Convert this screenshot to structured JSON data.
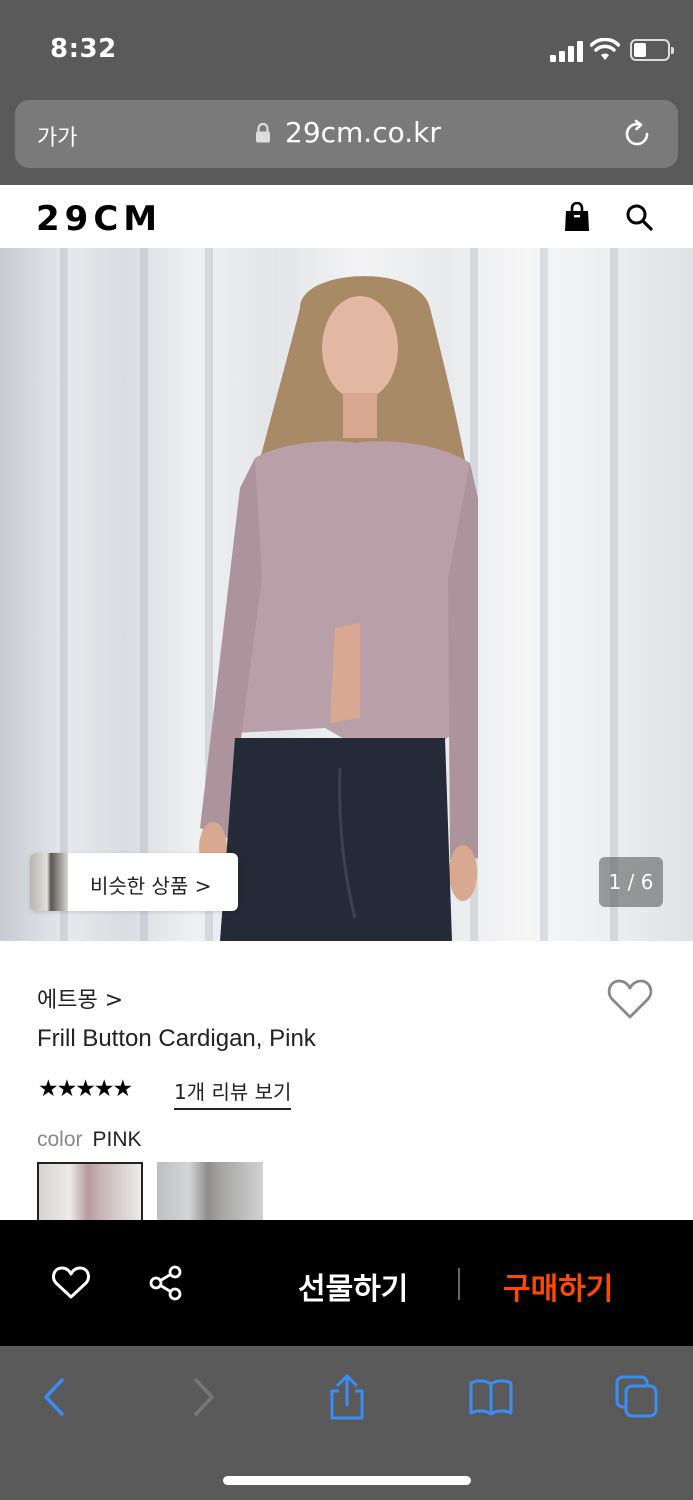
{
  "status_bar": {
    "time": "8:32"
  },
  "browser": {
    "text_size_button": "가가",
    "url": "29cm.co.kr"
  },
  "site_header": {
    "logo": "29CM"
  },
  "hero": {
    "similar_products_label": "비슷한 상품 >",
    "pager": "1 / 6"
  },
  "product": {
    "brand": "에트몽 >",
    "name": "Frill Button Cardigan, Pink",
    "stars": "★★★★★",
    "rating": 5,
    "review_link": "1개 리뷰 보기",
    "color_label": "color",
    "color_value": "PINK"
  },
  "action_bar": {
    "gift_label": "선물하기",
    "buy_label": "구매하기",
    "buy_color": "#ff4800"
  },
  "icons": [
    "lock-icon",
    "reload-icon",
    "shopping-bag-icon",
    "search-icon",
    "heart-icon",
    "share-icon",
    "back-icon",
    "forward-icon",
    "share-sheet-icon",
    "bookmarks-icon",
    "tabs-icon"
  ]
}
